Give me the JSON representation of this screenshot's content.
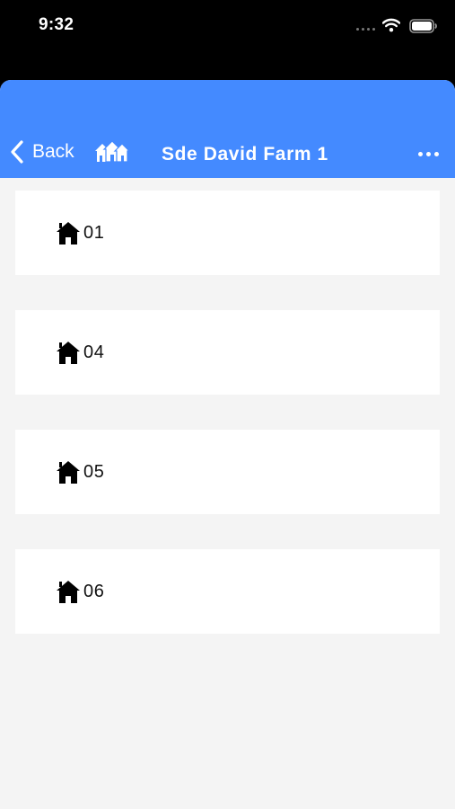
{
  "status_bar": {
    "time": "9:32",
    "wifi_icon": "wifi-icon",
    "battery_icon": "battery-icon"
  },
  "nav": {
    "back_label": "Back",
    "back_icon": "chevron-left-icon",
    "farm_icon": "farm-houses-icon",
    "title": "Sde David Farm 1",
    "more_icon": "more-dots-icon",
    "bar_color": "#448aff"
  },
  "houses": [
    {
      "label": "01",
      "icon": "house-icon"
    },
    {
      "label": "04",
      "icon": "house-icon"
    },
    {
      "label": "05",
      "icon": "house-icon"
    },
    {
      "label": "06",
      "icon": "house-icon"
    }
  ]
}
